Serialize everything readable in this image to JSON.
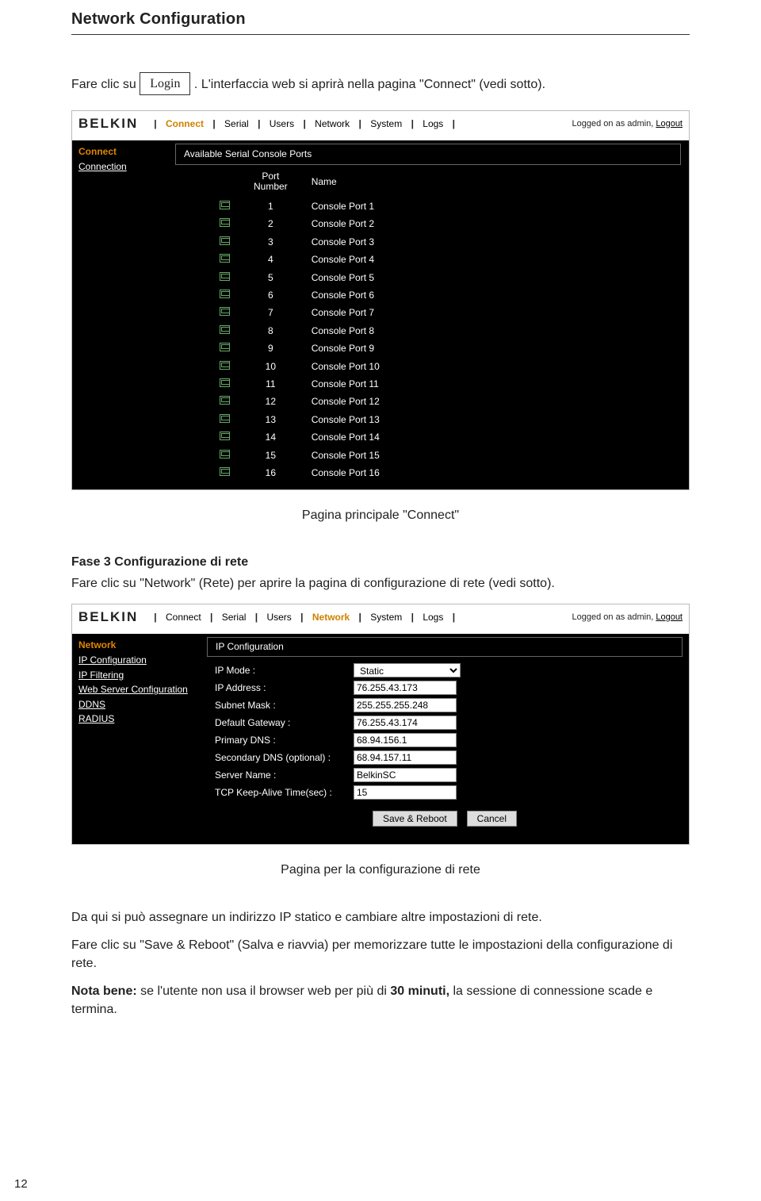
{
  "section_title": "Network Configuration",
  "intro": {
    "pre": "Fare clic su ",
    "login_label": "Login",
    "post": " . L'interfaccia web si aprirà nella pagina \"Connect\" (vedi sotto)."
  },
  "shot1": {
    "brand": "BELKIN",
    "tabs": [
      "Connect",
      "Serial",
      "Users",
      "Network",
      "System",
      "Logs"
    ],
    "active_tab": "Connect",
    "logged_text": "Logged on as admin, ",
    "logout": "Logout",
    "sidebar": {
      "head": "Connect",
      "items": [
        "Connection"
      ]
    },
    "panel_title": "Available Serial Console Ports",
    "col1": "Port Number",
    "col2": "Name",
    "ports": [
      {
        "num": "1",
        "name": "Console Port 1"
      },
      {
        "num": "2",
        "name": "Console Port 2"
      },
      {
        "num": "3",
        "name": "Console Port 3"
      },
      {
        "num": "4",
        "name": "Console Port 4"
      },
      {
        "num": "5",
        "name": "Console Port 5"
      },
      {
        "num": "6",
        "name": "Console Port 6"
      },
      {
        "num": "7",
        "name": "Console Port 7"
      },
      {
        "num": "8",
        "name": "Console Port 8"
      },
      {
        "num": "9",
        "name": "Console Port 9"
      },
      {
        "num": "10",
        "name": "Console Port 10"
      },
      {
        "num": "11",
        "name": "Console Port 11"
      },
      {
        "num": "12",
        "name": "Console Port 12"
      },
      {
        "num": "13",
        "name": "Console Port 13"
      },
      {
        "num": "14",
        "name": "Console Port 14"
      },
      {
        "num": "15",
        "name": "Console Port 15"
      },
      {
        "num": "16",
        "name": "Console Port 16"
      }
    ]
  },
  "caption1": "Pagina principale \"Connect\"",
  "step3": {
    "head": "Fase 3 Configurazione di rete",
    "text": "Fare clic su \"Network\" (Rete) per aprire la pagina di configurazione di rete (vedi sotto)."
  },
  "shot2": {
    "brand": "BELKIN",
    "tabs": [
      "Connect",
      "Serial",
      "Users",
      "Network",
      "System",
      "Logs"
    ],
    "active_tab": "Network",
    "logged_text": "Logged on as admin, ",
    "logout": "Logout",
    "sidebar": {
      "head": "Network",
      "items": [
        "IP Configuration",
        "IP Filtering",
        "Web Server Configuration",
        "DDNS",
        "RADIUS"
      ]
    },
    "panel_title": "IP Configuration",
    "fields": {
      "ip_mode_label": "IP Mode :",
      "ip_mode_value": "Static",
      "ip_addr_label": "IP Address :",
      "ip_addr_value": "76.255.43.173",
      "subnet_label": "Subnet Mask :",
      "subnet_value": "255.255.255.248",
      "gateway_label": "Default Gateway :",
      "gateway_value": "76.255.43.174",
      "pdns_label": "Primary DNS :",
      "pdns_value": "68.94.156.1",
      "sdns_label": "Secondary DNS (optional) :",
      "sdns_value": "68.94.157.11",
      "srvname_label": "Server Name :",
      "srvname_value": "BelkinSC",
      "keepalive_label": "TCP Keep-Alive Time(sec) :",
      "keepalive_value": "15"
    },
    "save_btn": "Save & Reboot",
    "cancel_btn": "Cancel"
  },
  "caption2": "Pagina per la configurazione di rete",
  "after": {
    "p1": "Da qui si può assegnare un indirizzo IP statico e cambiare altre impostazioni di rete.",
    "p2": "Fare clic su \"Save & Reboot\" (Salva e riavvia) per memorizzare tutte le impostazioni della configurazione di rete.",
    "p3_pre": "Nota bene:",
    "p3_mid": "  se l'utente non usa il browser web per più di ",
    "p3_bold": "30 minuti,",
    "p3_post": " la sessione di connessione scade e termina."
  },
  "page_number": "12"
}
